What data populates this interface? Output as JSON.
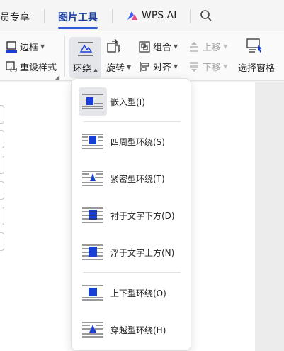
{
  "tabs": {
    "member": "员专享",
    "picture_tools": "图片工具",
    "wps_ai": "WPS AI"
  },
  "ribbon": {
    "border": "边框",
    "reset_style": "重设样式",
    "wrap": "环绕",
    "rotate": "旋转",
    "group": "组合",
    "align": "对齐",
    "bring_up": "上移",
    "send_down": "下移",
    "selection_pane": "选择窗格"
  },
  "wrap_menu": {
    "items": [
      {
        "label": "嵌入型(I)"
      },
      {
        "label": "四周型环绕(S)"
      },
      {
        "label": "紧密型环绕(T)"
      },
      {
        "label": "衬于文字下方(D)"
      },
      {
        "label": "浮于文字上方(N)"
      },
      {
        "label": "上下型环绕(O)"
      },
      {
        "label": "穿越型环绕(H)"
      }
    ]
  },
  "colors": {
    "accent": "#2b5bd7",
    "active_tab": "#1a3f9c",
    "border_underline": "#1a3fd4"
  }
}
